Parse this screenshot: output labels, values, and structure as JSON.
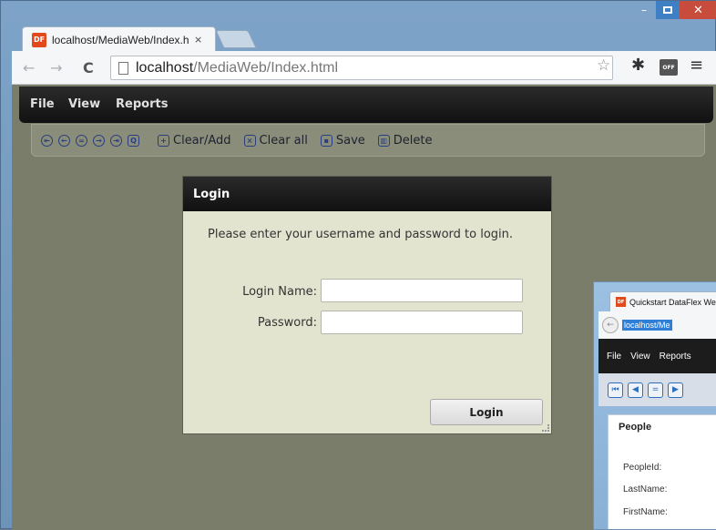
{
  "browser": {
    "tab_title": "localhost/MediaWeb/Index.html",
    "favicon_text": "DF",
    "tab_close": "×",
    "url_host": "localhost",
    "url_path": "/MediaWeb/Index.html",
    "ext_off_label": "OFF",
    "minimize_glyph": "–",
    "close_glyph": "✕"
  },
  "app": {
    "menu": [
      "File",
      "View",
      "Reports"
    ],
    "toolbar_actions": [
      "Clear/Add",
      "Clear all",
      "Save",
      "Delete"
    ]
  },
  "login": {
    "title": "Login",
    "message": "Please enter your username and password to login.",
    "login_name_label": "Login Name:",
    "password_label": "Password:",
    "login_name_value": "",
    "password_value": "",
    "button_label": "Login"
  },
  "second_window": {
    "tab_title": "Quickstart DataFlex We",
    "url": "localhost/Me",
    "menu": [
      "File",
      "View",
      "Reports"
    ],
    "panel_title": "People",
    "fields": [
      "PeopleId:",
      "LastName:",
      "FirstName:"
    ]
  },
  "colors": {
    "accent_close": "#c74c3c",
    "menubar": "#111111",
    "dialog_bg": "#e2e4cf",
    "viewport_bg": "#7a7d6a"
  }
}
